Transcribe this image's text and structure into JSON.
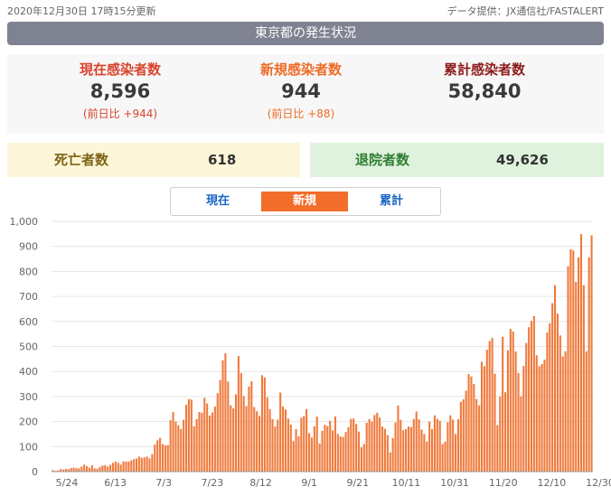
{
  "header": {
    "date": "2020年12月30日 17時15分更新",
    "source": "データ提供：JX通信社/FASTALERT",
    "title": "東京都の発生状況"
  },
  "summary": {
    "current": {
      "label": "現在感染者数",
      "value": "8,596",
      "sub": "(前日比 +944)"
    },
    "new": {
      "label": "新規感染者数",
      "value": "944",
      "sub": "(前日比 +88)"
    },
    "total": {
      "label": "累計感染者数",
      "value": "58,840"
    }
  },
  "cards": {
    "deaths": {
      "label": "死亡者数",
      "value": "618"
    },
    "recovered": {
      "label": "退院者数",
      "value": "49,626"
    }
  },
  "tabs": [
    "現在",
    "新規",
    "累計"
  ],
  "active_tab": "新規",
  "colors": {
    "bar": "#f07a3c",
    "active_tab": "#f36d2b",
    "title_bar": "#7f8290"
  },
  "chart_data": {
    "type": "bar",
    "ylim": [
      0,
      1000
    ],
    "yticks": [
      "0",
      "100",
      "200",
      "300",
      "400",
      "500",
      "600",
      "700",
      "800",
      "900",
      "1,000"
    ],
    "xticks": [
      "5/24",
      "6/13",
      "7/3",
      "7/23",
      "8/12",
      "9/1",
      "9/21",
      "10/11",
      "10/31",
      "11/20",
      "12/10",
      "12/30"
    ],
    "grid": true,
    "values": [
      6,
      3,
      5,
      10,
      8,
      11,
      10,
      14,
      16,
      14,
      13,
      20,
      28,
      22,
      15,
      25,
      13,
      12,
      19,
      24,
      26,
      20,
      27,
      35,
      40,
      35,
      28,
      41,
      40,
      40,
      45,
      50,
      52,
      60,
      55,
      57,
      60,
      53,
      70,
      108,
      125,
      135,
      110,
      105,
      106,
      205,
      238,
      200,
      185,
      170,
      207,
      267,
      290,
      288,
      181,
      210,
      238,
      235,
      295,
      272,
      224,
      236,
      260,
      313,
      366,
      445,
      473,
      360,
      265,
      253,
      309,
      462,
      394,
      302,
      262,
      340,
      361,
      258,
      241,
      222,
      385,
      376,
      297,
      250,
      210,
      180,
      208,
      316,
      260,
      248,
      212,
      188,
      122,
      170,
      141,
      215,
      222,
      250,
      154,
      136,
      181,
      220,
      112,
      163,
      187,
      182,
      203,
      165,
      220,
      150,
      140,
      138,
      158,
      177,
      211,
      212,
      190,
      160,
      97,
      110,
      195,
      210,
      200,
      226,
      235,
      216,
      180,
      171,
      146,
      77,
      134,
      196,
      264,
      207,
      165,
      170,
      180,
      178,
      210,
      240,
      209,
      168,
      150,
      120,
      200,
      170,
      225,
      211,
      203,
      110,
      120,
      197,
      225,
      208,
      150,
      209,
      279,
      289,
      323,
      390,
      380,
      350,
      290,
      265,
      439,
      421,
      487,
      522,
      534,
      391,
      186,
      300,
      539,
      317,
      485,
      570,
      560,
      480,
      394,
      300,
      422,
      514,
      577,
      602,
      621,
      465,
      421,
      430,
      447,
      556,
      593,
      673,
      745,
      631,
      544,
      460,
      481,
      821,
      888,
      884,
      758,
      856,
      949,
      745,
      481,
      856,
      944
    ]
  }
}
